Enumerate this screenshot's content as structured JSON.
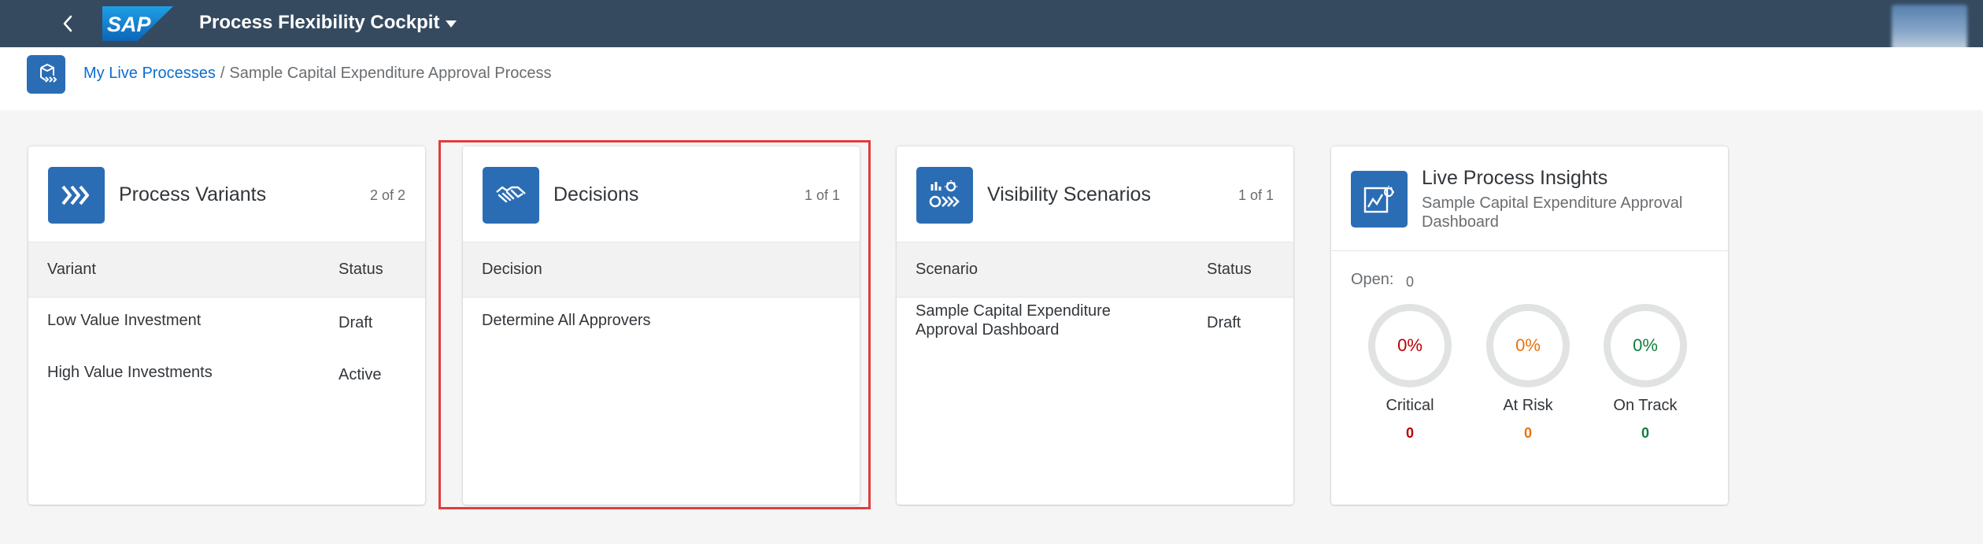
{
  "shell": {
    "app_title": "Process Flexibility Cockpit",
    "logo_text": "SAP"
  },
  "breadcrumb": {
    "link": "My Live Processes",
    "separator": "/",
    "current": "Sample Capital Expenditure Approval Process"
  },
  "cards": {
    "variants": {
      "title": "Process Variants",
      "count": "2 of 2",
      "col1": "Variant",
      "col2": "Status",
      "rows": [
        {
          "name": "Low Value Investment",
          "status": "Draft"
        },
        {
          "name": "High Value Investments",
          "status": "Active"
        }
      ]
    },
    "decisions": {
      "title": "Decisions",
      "count": "1 of 1",
      "col1": "Decision",
      "rows": [
        {
          "name": "Determine All Approvers"
        }
      ]
    },
    "scenarios": {
      "title": "Visibility Scenarios",
      "count": "1 of 1",
      "col1": "Scenario",
      "col2": "Status",
      "rows": [
        {
          "name_line1": "Sample Capital Expenditure",
          "name_line2": "Approval Dashboard",
          "status": "Draft"
        }
      ]
    },
    "insights": {
      "title": "Live Process Insights",
      "subtitle": "Sample Capital Expenditure Approval Dashboard",
      "open_label": "Open:",
      "open_value": "0",
      "metrics": [
        {
          "label": "Critical",
          "percent": "0%",
          "count": "0",
          "color": "#bb0000"
        },
        {
          "label": "At Risk",
          "percent": "0%",
          "count": "0",
          "color": "#e9730c"
        },
        {
          "label": "On Track",
          "percent": "0%",
          "count": "0",
          "color": "#107e3e"
        }
      ]
    }
  },
  "colors": {
    "shell": "#354a5f",
    "accent": "#2b6db4",
    "link": "#0a6ed1",
    "highlight": "#e03c3c"
  }
}
